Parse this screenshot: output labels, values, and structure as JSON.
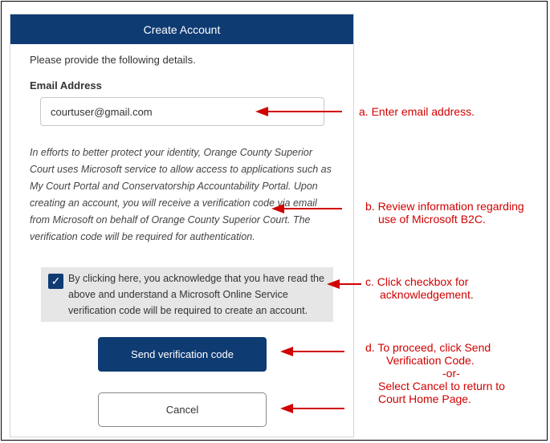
{
  "form": {
    "title": "Create Account",
    "intro": "Please provide the following details.",
    "email_label": "Email Address",
    "email_value": "courtuser@gmail.com",
    "info_text": "In efforts to better protect your identity, Orange County Superior Court uses Microsoft service to allow access to applications such as My Court Portal and Conservatorship Accountability Portal. Upon creating an account, you will receive a verification code via email from Microsoft on behalf of Orange County Superior Court. The verification code will be required for authentication.",
    "ack_checked": true,
    "ack_text": "By clicking here, you acknowledge that you have read the above and understand a Microsoft Online Service verification code will be required to create an account.",
    "send_label": "Send verification code",
    "cancel_label": "Cancel"
  },
  "annotations": {
    "a": "a. Enter email address.",
    "b_line1": "b. Review information regarding",
    "b_line2": "use of Microsoft B2C.",
    "c_line1": "c. Click checkbox for",
    "c_line2": "acknowledgement.",
    "d_line1": "d. To proceed, click Send",
    "d_line2": "Verification Code.",
    "d_line3": "-or-",
    "d_line4": "Select Cancel to return to",
    "d_line5": "Court Home Page."
  },
  "colors": {
    "primary": "#0f3b73",
    "annotation": "#d10000",
    "ack_background": "#e6e6e6"
  },
  "icons": {
    "checkbox": "checkmark-icon",
    "arrow": "left-arrow-icon"
  }
}
